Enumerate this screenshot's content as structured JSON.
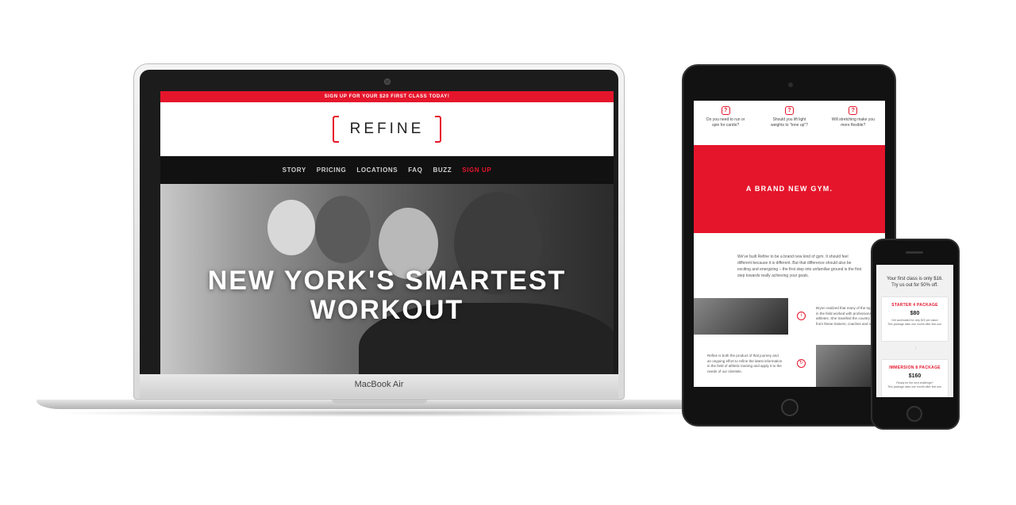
{
  "laptop": {
    "brand_label": "MacBook Air",
    "site": {
      "banner": "SIGN UP FOR YOUR $20 FIRST CLASS TODAY!",
      "logo_text": "REFINE",
      "nav": [
        "STORY",
        "PRICING",
        "LOCATIONS",
        "FAQ",
        "BUZZ",
        "SIGN UP"
      ],
      "hero_line1": "NEW YORK'S SMARTEST",
      "hero_line2": "WORKOUT"
    }
  },
  "tablet": {
    "questions": [
      {
        "icon": "?",
        "line1": "Do you need to run or",
        "line2": "spin for cardio?"
      },
      {
        "icon": "?",
        "line1": "Should you lift light",
        "line2": "weights to \"tone up\"?"
      },
      {
        "icon": "?",
        "line1": "Will stretching make you",
        "line2": "more flexible?"
      }
    ],
    "band_title": "A BRAND NEW GYM.",
    "paragraph": "We've built Refine to be a brand new kind of gym. It should feel different because it is different. But that difference should also be exciting and energizing – the first step into unfamiliar ground is the first step towards really achieving your goals.",
    "bryn_text": "Brynn realized that many of the top minds in the field worked with professional athletes. She travelled the country to learn from these trainers, coaches and scientists.",
    "refine_text": "Refine is both the product of that journey and an ongoing effort to refine the latest information in the field of athletic training and apply it to the needs of our clientele."
  },
  "phone": {
    "intro_line1": "Your first class is only $16.",
    "intro_line2": "Try us out for 50% off.",
    "packages": [
      {
        "title": "STARTER 4 PACKAGE",
        "price": "$80",
        "line1": "Get acclimated for only $20 per class!",
        "line2": "This package lasts one month after first use."
      },
      {
        "title": "IMMERSION 8 PACKAGE",
        "price": "$160",
        "line1": "Ready for the next challenge?",
        "line2": "This package lasts one month after first use."
      }
    ],
    "arrow": "↓"
  },
  "colors": {
    "accent": "#e5152b",
    "nav_bg": "#111111",
    "device_dark": "#121212"
  }
}
